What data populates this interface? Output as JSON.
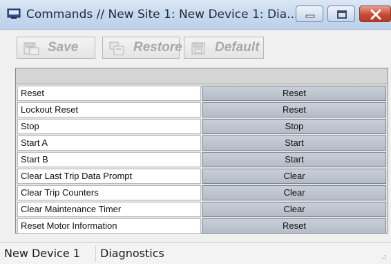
{
  "window": {
    "title": "Commands // New Site 1: New Device 1: Dia...",
    "controls": [
      "minimize-icon",
      "maximize-icon",
      "close-icon"
    ]
  },
  "toolbar": {
    "save_label": "Save",
    "restore_label": "Restore",
    "default_label": "Default",
    "enabled": false
  },
  "commands": [
    {
      "label": "Reset",
      "action": "Reset"
    },
    {
      "label": "Lockout Reset",
      "action": "Reset"
    },
    {
      "label": "Stop",
      "action": "Stop"
    },
    {
      "label": "Start A",
      "action": "Start"
    },
    {
      "label": "Start B",
      "action": "Start"
    },
    {
      "label": "Clear Last Trip Data Prompt",
      "action": "Clear"
    },
    {
      "label": "Clear Trip Counters",
      "action": "Clear"
    },
    {
      "label": "Clear Maintenance Timer",
      "action": "Clear"
    },
    {
      "label": "Reset Motor Information",
      "action": "Reset"
    }
  ],
  "statusbar": {
    "device": "New Device 1",
    "section": "Diagnostics"
  },
  "colors": {
    "titlebar": "#c6d8ee",
    "close_button": "#c94a32",
    "action_button": "#b4bcc8"
  }
}
